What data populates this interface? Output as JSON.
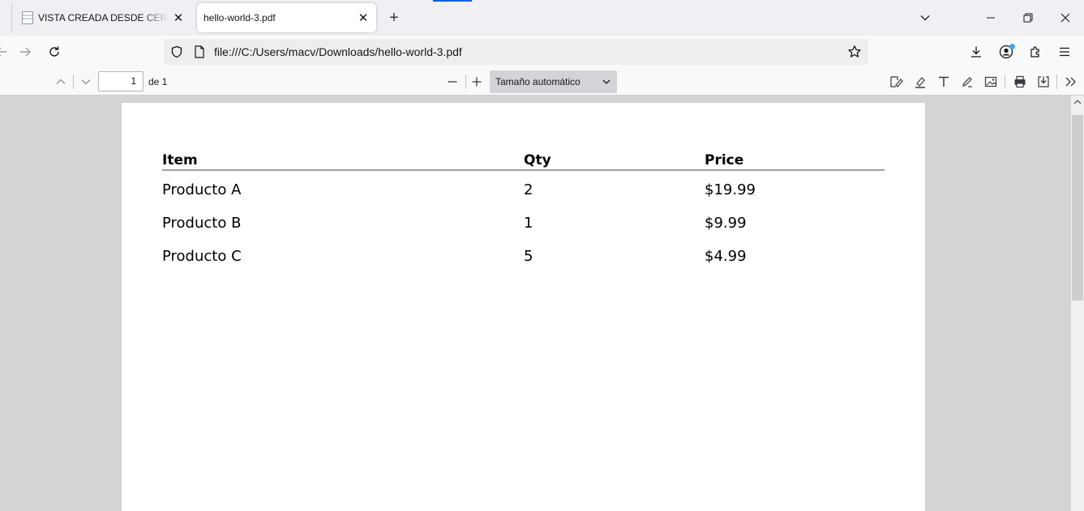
{
  "tabs": [
    {
      "title": "VISTA CREADA DESDE CERO - W",
      "active": false,
      "favicon": "document-icon"
    },
    {
      "title": "hello-world-3.pdf",
      "active": true
    }
  ],
  "tab_close_glyph": "✕",
  "new_tab_glyph": "+",
  "address_bar": {
    "url": "file:///C:/Users/macv/Downloads/hello-world-3.pdf"
  },
  "pdf_toolbar": {
    "page_number": "1",
    "page_count": "de 1",
    "zoom_out": "—",
    "zoom_in": "+",
    "zoom_value": "Tamaño automático"
  },
  "document": {
    "table": {
      "headers": [
        "Item",
        "Qty",
        "Price"
      ],
      "rows": [
        [
          "Producto A",
          "2",
          "$19.99"
        ],
        [
          "Producto B",
          "1",
          "$9.99"
        ],
        [
          "Producto C",
          "5",
          "$4.99"
        ]
      ]
    }
  },
  "colors": {
    "accent": "#0061e0",
    "account_dot": "#3fa5f0"
  }
}
